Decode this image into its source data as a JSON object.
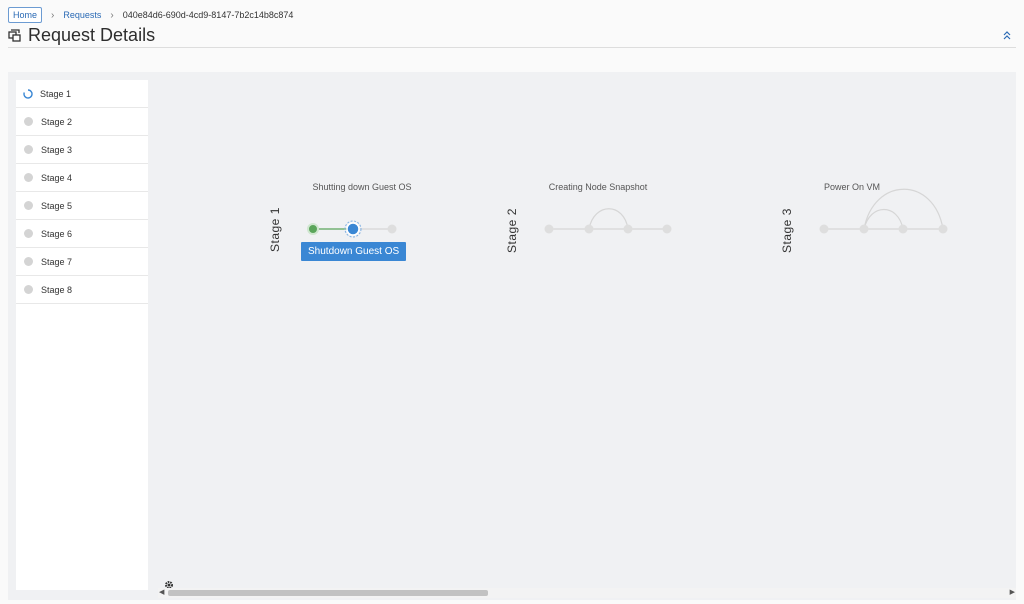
{
  "breadcrumb": {
    "home": "Home",
    "requests": "Requests",
    "current": "040e84d6-690d-4cd9-8147-7b2c14b8c874"
  },
  "header": {
    "title": "Request Details",
    "title_icon": "request-details-icon",
    "collapse_icon": "double-chevron-up-icon"
  },
  "stage_list": [
    {
      "label": "Stage 1",
      "status": "in-progress"
    },
    {
      "label": "Stage 2",
      "status": "pending"
    },
    {
      "label": "Stage 3",
      "status": "pending"
    },
    {
      "label": "Stage 4",
      "status": "pending"
    },
    {
      "label": "Stage 5",
      "status": "pending"
    },
    {
      "label": "Stage 6",
      "status": "pending"
    },
    {
      "label": "Stage 7",
      "status": "pending"
    },
    {
      "label": "Stage 8",
      "status": "pending"
    }
  ],
  "stages": [
    {
      "label": "Stage 1",
      "title": "Shutting down Guest OS"
    },
    {
      "label": "Stage 2",
      "title": "Creating Node Snapshot"
    },
    {
      "label": "Stage 3",
      "title": "Power On VM"
    }
  ],
  "tooltip": "Shutdown Guest OS",
  "colors": {
    "done": "#5aa55a",
    "active": "#3a87d4",
    "pending": "#d6d6d6",
    "accent": "#2a6ab5"
  }
}
